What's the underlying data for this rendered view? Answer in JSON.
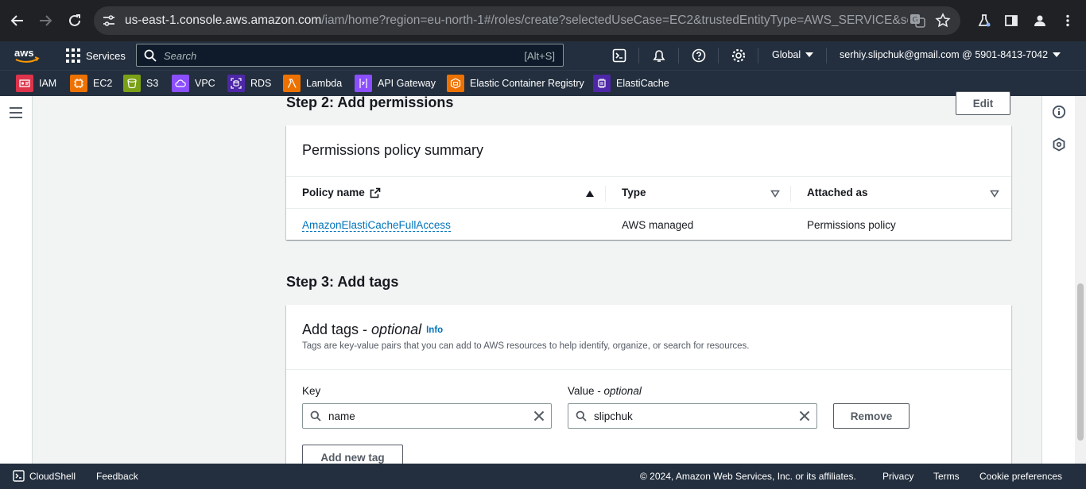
{
  "browser": {
    "url_host": "us-east-1.console.aws.amazon.com",
    "url_path": "/iam/home?region=eu-north-1#/roles/create?selectedUseCase=EC2&trustedEntityType=AWS_SERVICE&selectedServic..."
  },
  "aws_nav": {
    "services_label": "Services",
    "search_placeholder": "Search",
    "search_shortcut": "[Alt+S]",
    "region": "Global",
    "account": "serhiy.slipchuk@gmail.com @ 5901-8413-7042"
  },
  "favorites": [
    {
      "label": "IAM",
      "color": "#dd344c"
    },
    {
      "label": "EC2",
      "color": "#ed7100"
    },
    {
      "label": "S3",
      "color": "#7aa116"
    },
    {
      "label": "VPC",
      "color": "#8c4fff"
    },
    {
      "label": "RDS",
      "color": "#4d27a8"
    },
    {
      "label": "Lambda",
      "color": "#ed7100"
    },
    {
      "label": "API Gateway",
      "color": "#8c4fff"
    },
    {
      "label": "Elastic Container Registry",
      "color": "#ed7100"
    },
    {
      "label": "ElastiCache",
      "color": "#4d27a8"
    }
  ],
  "step2": {
    "heading": "Step 2: Add permissions",
    "edit_label": "Edit",
    "summary_title": "Permissions policy summary",
    "columns": [
      "Policy name",
      "Type",
      "Attached as"
    ],
    "rows": [
      {
        "policy_name": "AmazonElastiCacheFullAccess",
        "type": "AWS managed",
        "attached_as": "Permissions policy"
      }
    ]
  },
  "step3": {
    "heading": "Step 3: Add tags",
    "card_title": "Add tags - ",
    "card_title_optional": "optional",
    "info_label": "Info",
    "description": "Tags are key-value pairs that you can add to AWS resources to help identify, organize, or search for resources.",
    "key_label": "Key",
    "value_label": "Value - ",
    "value_label_optional": "optional",
    "tag": {
      "key": "name",
      "value": "slipchuk"
    },
    "remove_label": "Remove",
    "add_label": "Add new tag"
  },
  "footer": {
    "cloudshell": "CloudShell",
    "feedback": "Feedback",
    "copyright": "© 2024, Amazon Web Services, Inc. or its affiliates.",
    "privacy": "Privacy",
    "terms": "Terms",
    "cookie": "Cookie preferences"
  }
}
